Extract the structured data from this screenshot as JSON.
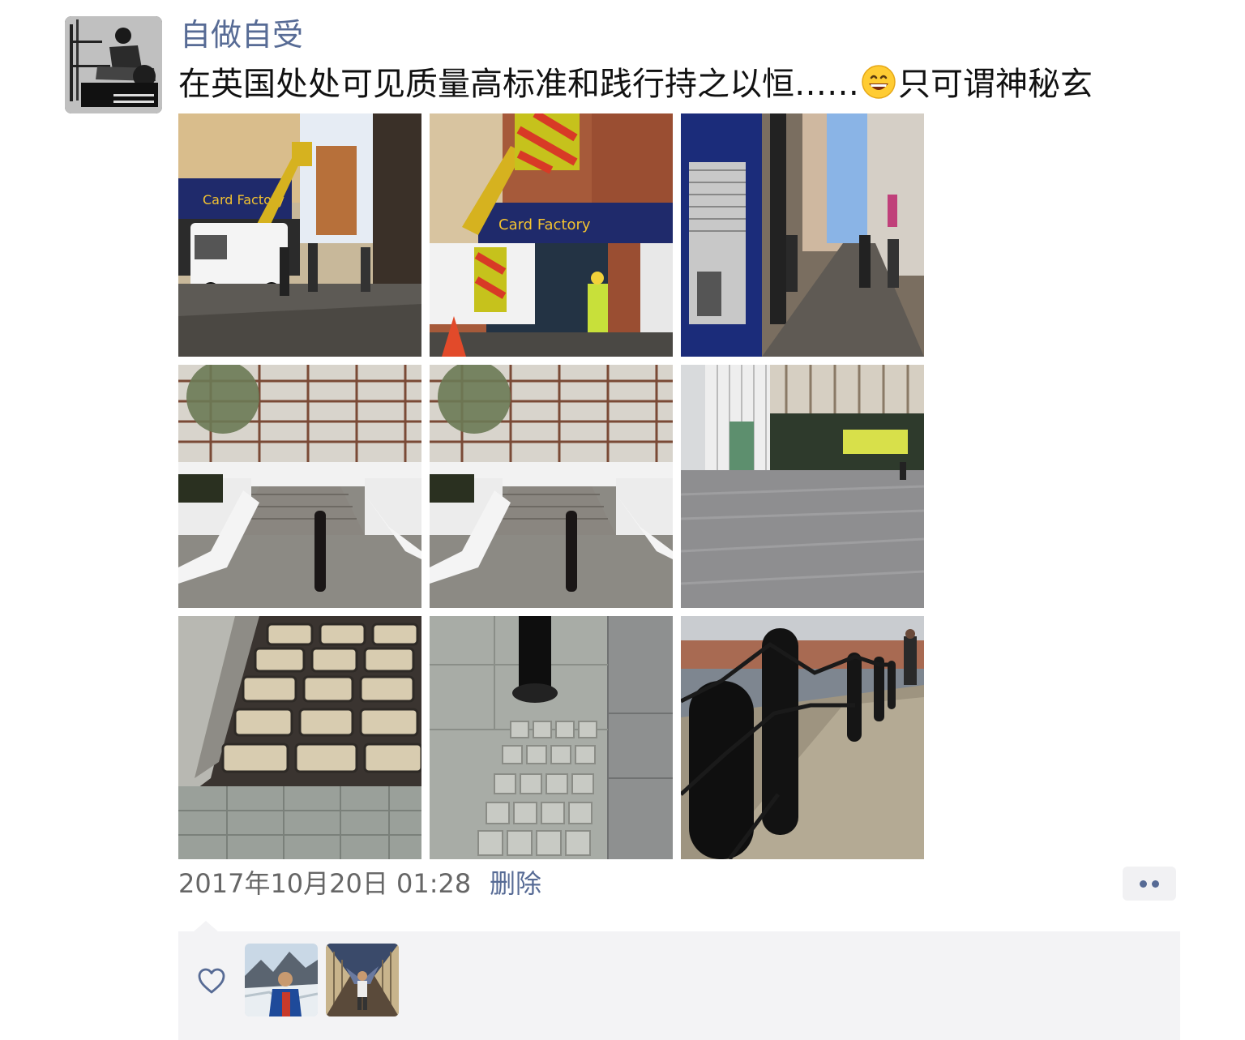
{
  "post": {
    "author": "自做自受",
    "text_before_emoji": "在英国处处可见质量高标准和践行持之以恒……",
    "emoji": "grinning-face-emoji",
    "text_after_emoji": "只可谓神秘玄",
    "photo_count": 9,
    "timestamp": "2017年10月20日 01:28",
    "delete_label": "删除",
    "more_icon": "more-dots-icon"
  },
  "photos": [
    {
      "subject": "Card Factory shop street with lift truck and white van"
    },
    {
      "subject": "Card Factory storefront, lift bucket and worker in hi-vis"
    },
    {
      "subject": "Pedestrian shopping street with shops"
    },
    {
      "subject": "Stone steps with central black bollard"
    },
    {
      "subject": "Stone steps with central black bollard"
    },
    {
      "subject": "Modern building and paved plaza"
    },
    {
      "subject": "Cobblestone pavement close-up"
    },
    {
      "subject": "Black bollard base in paving"
    },
    {
      "subject": "Waterfront black bollards with chains"
    }
  ],
  "likes": {
    "icon": "heart-outline-icon",
    "likers": [
      {
        "avatar": "liker-glacier-photo"
      },
      {
        "avatar": "liker-hall-photo"
      }
    ]
  },
  "colors": {
    "link": "#576b95",
    "text": "#111111",
    "muted": "#666666",
    "panel": "#f3f3f5"
  }
}
